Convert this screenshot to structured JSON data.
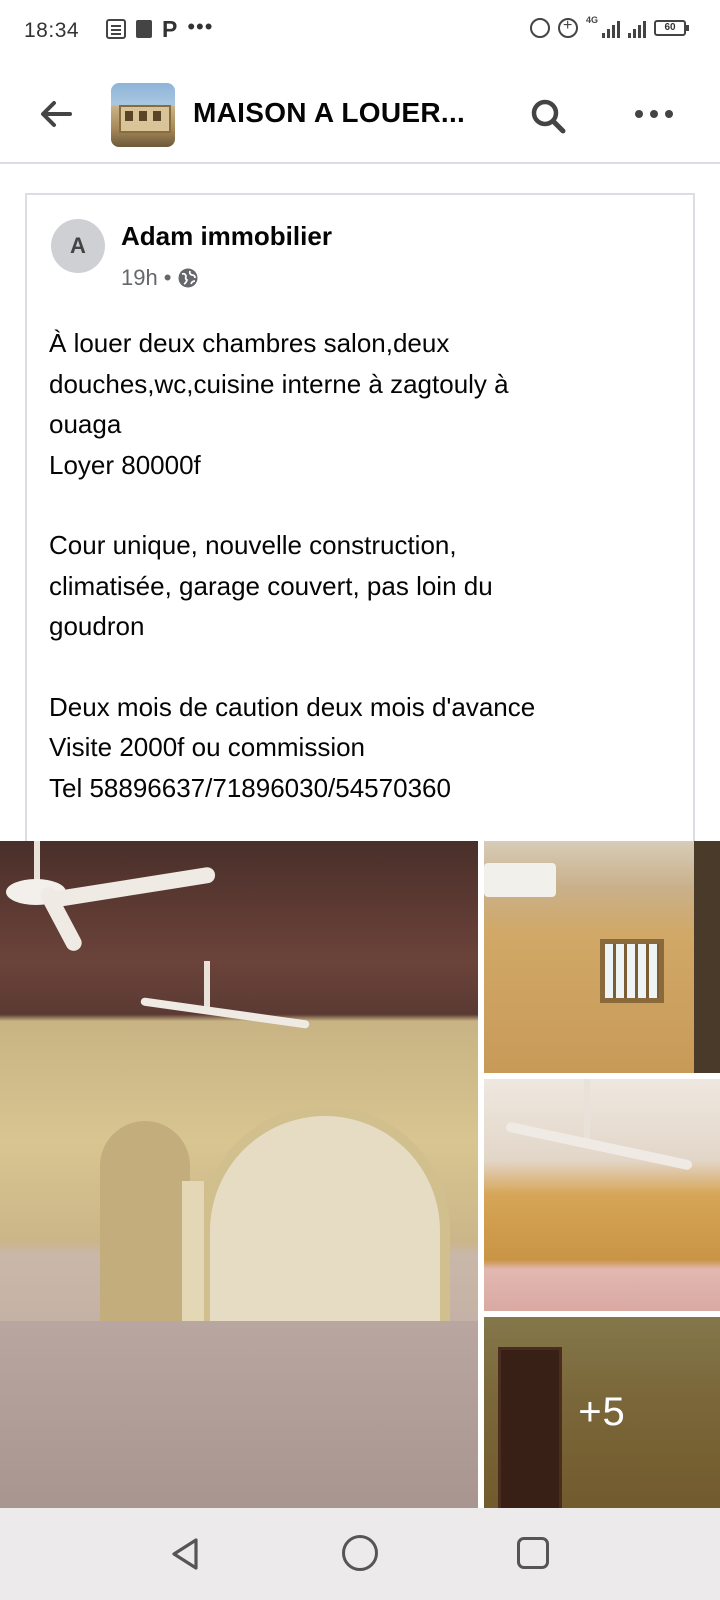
{
  "status_bar": {
    "time": "18:34",
    "left_icons": [
      "document-icon",
      "lock-icon",
      "p-app-icon",
      "more-notifications-icon"
    ],
    "p_glyph": "P",
    "dots_glyph": "•••",
    "network": "4G",
    "battery": "60"
  },
  "header": {
    "title": "MAISON A LOUER...",
    "back_icon": "back-arrow-icon",
    "search_icon": "search-icon",
    "more_icon": "more-icon"
  },
  "post": {
    "avatar_letter": "A",
    "author": "Adam immobilier",
    "time": "19h",
    "separator": "•",
    "audience_icon": "globe-icon",
    "lines": {
      "l1": "À louer deux chambres salon,deux",
      "l2": "douches,wc,cuisine interne à zagtouly à",
      "l3": "ouaga",
      "l4": "Loyer 80000f",
      "l5": "Cour unique, nouvelle construction,",
      "l6": "climatisée, garage couvert, pas loin du",
      "l7": "goudron",
      "l8": "Deux mois de caution deux mois d'avance",
      "l9": "Visite 2000f ou commission",
      "l10": "Tel 58896637/71896030/54570360"
    },
    "more_photos": "+5"
  },
  "nav_bar": {
    "icons": [
      "nav-back-icon",
      "nav-home-icon",
      "nav-recents-icon"
    ]
  },
  "colors": {
    "text_primary": "#050505",
    "text_secondary": "#65676b",
    "divider": "#dadde1",
    "nav_bg": "#eceaea"
  }
}
